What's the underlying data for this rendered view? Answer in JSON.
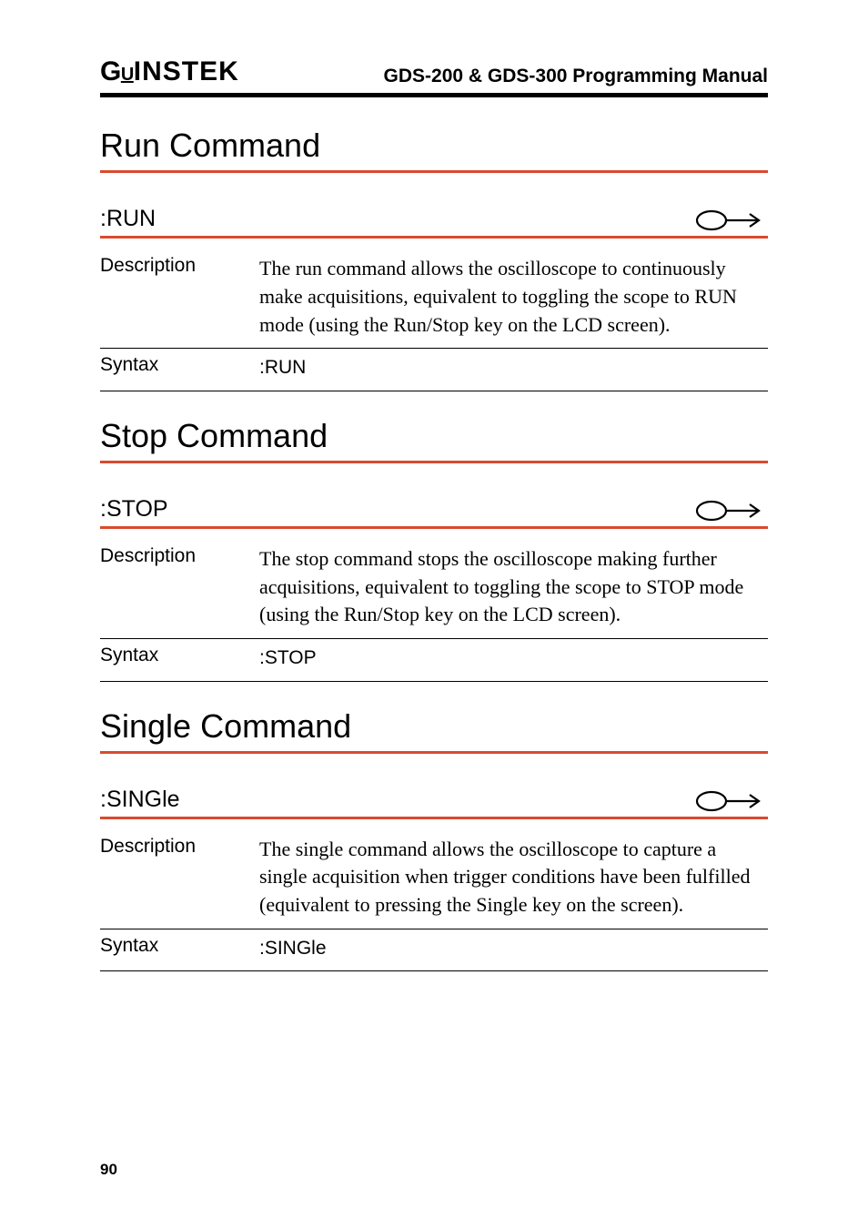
{
  "header": {
    "logo_g": "G",
    "logo_u": "U",
    "logo_instek": "INSTEK",
    "title": "GDS-200 & GDS-300 Programming Manual"
  },
  "sections": [
    {
      "heading": "Run Command",
      "cmd": ":RUN",
      "desc_label": "Description",
      "desc": "The run command allows the oscilloscope to continuously make acquisitions, equivalent to toggling the scope to RUN mode (using the Run/Stop key on the LCD screen).",
      "syntax_label": "Syntax",
      "syntax": ":RUN"
    },
    {
      "heading": "Stop Command",
      "cmd": ":STOP",
      "desc_label": "Description",
      "desc": "The stop command stops the oscilloscope making further acquisitions, equivalent to toggling the scope to STOP mode (using the Run/Stop key on the LCD screen).",
      "syntax_label": "Syntax",
      "syntax": ":STOP"
    },
    {
      "heading": "Single Command",
      "cmd": ":SINGle",
      "desc_label": "Description",
      "desc": "The single command allows the oscilloscope to capture a single acquisition when trigger conditions have been fulfilled (equivalent to pressing the Single key on the screen).",
      "syntax_label": "Syntax",
      "syntax": ":SINGle"
    }
  ],
  "page_number": "90"
}
